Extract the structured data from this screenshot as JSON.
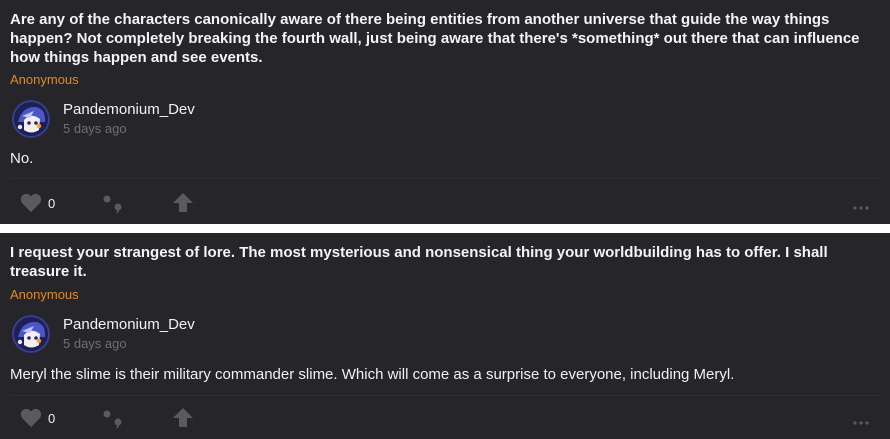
{
  "posts": [
    {
      "question": "Are any of the characters canonically aware of there being entities from another universe that guide the way things happen? Not completely breaking the fourth wall, just being aware that there's *something* out there that can influence how things happen and see events.",
      "asker": "Anonymous",
      "author": {
        "name": "Pandemonium_Dev",
        "time": "5 days ago",
        "avatar_icon": "anime-character-avatar"
      },
      "answer": "No.",
      "likes": "0"
    },
    {
      "question": "I request your strangest of lore. The most mysterious and nonsensical thing your worldbuilding has to offer. I shall treasure it.",
      "asker": "Anonymous",
      "author": {
        "name": "Pandemonium_Dev",
        "time": "5 days ago",
        "avatar_icon": "anime-character-avatar"
      },
      "answer": "Meryl the slime is their military commander slime. Which will come as a surprise to everyone, including Meryl.",
      "likes": "0"
    }
  ],
  "icons": {
    "like": "heart-icon",
    "quote": "quote-icon",
    "share": "share-arrow-icon",
    "more": "more-dots-icon"
  },
  "colors": {
    "card_bg": "#25252a",
    "accent": "#e58a1f",
    "muted": "#6f6f74",
    "icon": "#5a5a60"
  }
}
